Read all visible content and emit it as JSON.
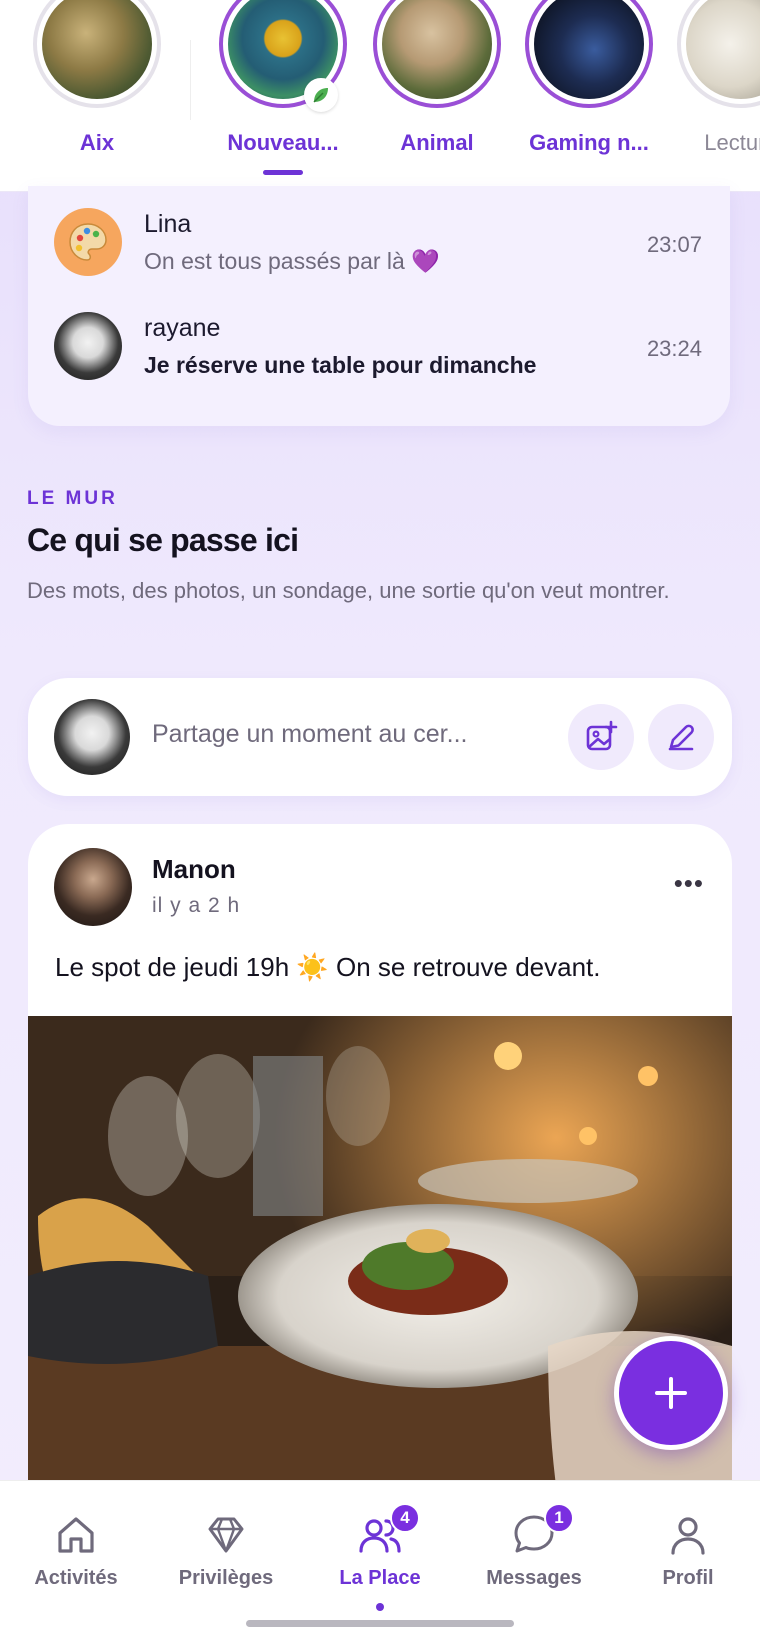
{
  "groups": [
    {
      "label": "Aix",
      "style": "plain"
    },
    {
      "label": "Nouveau...",
      "style": "active"
    },
    {
      "label": "Animal",
      "style": "ring"
    },
    {
      "label": "Gaming n...",
      "style": "ring"
    },
    {
      "label": "Lecture",
      "style": "plain"
    }
  ],
  "conversations": [
    {
      "name": "Lina",
      "message": "On est tous passés par là 💜",
      "time": "23:07"
    },
    {
      "name": "rayane",
      "message": "Je réserve une table pour dimanche",
      "time": "23:24"
    }
  ],
  "wall": {
    "eyebrow": "LE MUR",
    "title": "Ce qui se passe ici",
    "subtitle": "Des mots, des photos, un sondage, une sortie qu'on veut montrer."
  },
  "composer": {
    "placeholder": "Partage un moment au cer..."
  },
  "post": {
    "author": "Manon",
    "time_ago": "il y a 2 h",
    "text": "Le spot de jeudi 19h ☀️ On se retrouve devant.",
    "more": "•••"
  },
  "fab": {
    "label": "+"
  },
  "nav": {
    "items": [
      {
        "label": "Activités",
        "icon": "home-icon"
      },
      {
        "label": "Privilèges",
        "icon": "diamond-icon"
      },
      {
        "label": "La Place",
        "icon": "people-icon",
        "badge": "4",
        "active": true
      },
      {
        "label": "Messages",
        "icon": "chat-icon",
        "badge": "1"
      },
      {
        "label": "Profil",
        "icon": "user-icon"
      }
    ]
  },
  "colors": {
    "accent": "#6d33d6",
    "fab": "#7a2fe0"
  }
}
